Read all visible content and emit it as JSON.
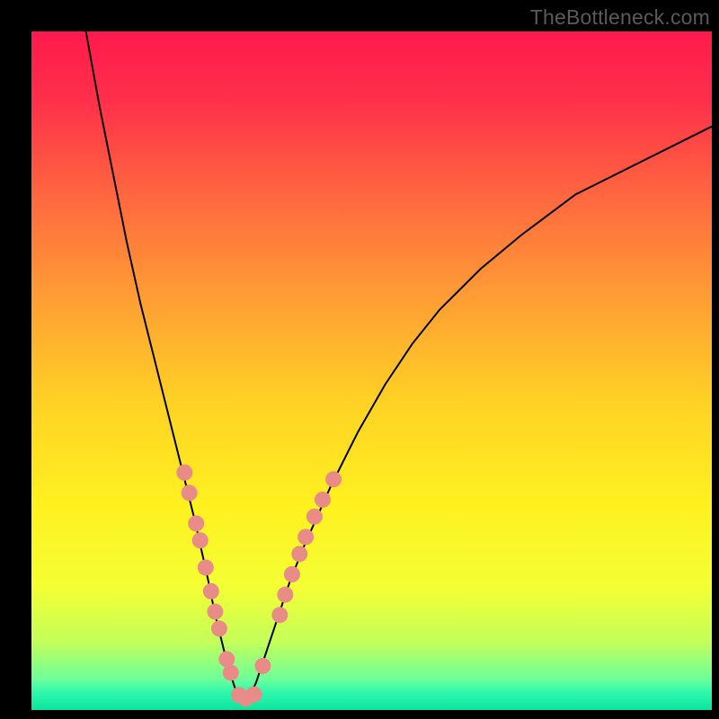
{
  "watermark": "TheBottleneck.com",
  "chart_data": {
    "type": "line",
    "title": "",
    "xlabel": "",
    "ylabel": "",
    "xlim": [
      0,
      100
    ],
    "ylim": [
      0,
      100
    ],
    "grid": false,
    "legend": false,
    "axes_visible": false,
    "background": {
      "type": "vertical-gradient",
      "stops": [
        {
          "offset": 0.0,
          "color": "#ff1a4d"
        },
        {
          "offset": 0.1,
          "color": "#ff2f4a"
        },
        {
          "offset": 0.25,
          "color": "#ff6a3f"
        },
        {
          "offset": 0.4,
          "color": "#ffa033"
        },
        {
          "offset": 0.55,
          "color": "#ffd324"
        },
        {
          "offset": 0.7,
          "color": "#fff120"
        },
        {
          "offset": 0.82,
          "color": "#f3ff33"
        },
        {
          "offset": 0.9,
          "color": "#c3ff5a"
        },
        {
          "offset": 0.955,
          "color": "#6cff9a"
        },
        {
          "offset": 0.975,
          "color": "#2cf7ad"
        },
        {
          "offset": 1.0,
          "color": "#0be49d"
        }
      ]
    },
    "series": [
      {
        "name": "bottleneck-curve",
        "stroke": "#000000",
        "stroke_width": 2,
        "note": "V-shaped curve; y is bottleneck percentage (100=worst red, 0=best green). Minimum near x≈31.",
        "x": [
          8,
          10,
          12,
          14,
          16,
          18,
          20,
          22,
          24,
          26,
          27,
          28,
          29,
          30,
          31,
          32,
          33,
          34,
          36,
          38,
          40,
          44,
          48,
          52,
          56,
          60,
          66,
          72,
          80,
          88,
          96,
          100
        ],
        "y": [
          100,
          89,
          79,
          69,
          60,
          52,
          44,
          36,
          28,
          19,
          14,
          10,
          6,
          3,
          1.5,
          2,
          4,
          7,
          13,
          19,
          24,
          33,
          41,
          48,
          54,
          59,
          65,
          70,
          76,
          80,
          84,
          86
        ]
      }
    ],
    "highlight_points": {
      "name": "highlighted-configurations",
      "color": "#e98b87",
      "radius": 9,
      "points": [
        {
          "x": 22.5,
          "y": 35
        },
        {
          "x": 23.2,
          "y": 32
        },
        {
          "x": 24.2,
          "y": 27.5
        },
        {
          "x": 24.8,
          "y": 25
        },
        {
          "x": 25.6,
          "y": 21
        },
        {
          "x": 26.4,
          "y": 17.5
        },
        {
          "x": 27.0,
          "y": 14.5
        },
        {
          "x": 27.6,
          "y": 12
        },
        {
          "x": 28.7,
          "y": 7.5
        },
        {
          "x": 29.3,
          "y": 5.5
        },
        {
          "x": 30.5,
          "y": 2.2
        },
        {
          "x": 31.5,
          "y": 1.7
        },
        {
          "x": 32.7,
          "y": 2.3
        },
        {
          "x": 34.0,
          "y": 6.5
        },
        {
          "x": 36.5,
          "y": 14
        },
        {
          "x": 37.3,
          "y": 17
        },
        {
          "x": 38.3,
          "y": 20
        },
        {
          "x": 39.4,
          "y": 23
        },
        {
          "x": 40.3,
          "y": 25.5
        },
        {
          "x": 41.6,
          "y": 28.5
        },
        {
          "x": 42.8,
          "y": 31
        },
        {
          "x": 44.4,
          "y": 34
        }
      ]
    }
  }
}
